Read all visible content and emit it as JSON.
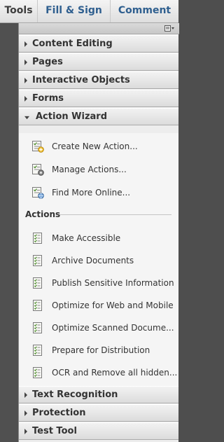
{
  "tabs": [
    {
      "label": "Tools"
    },
    {
      "label": "Fill & Sign"
    },
    {
      "label": "Comment"
    }
  ],
  "panel": {
    "options_icon": "panel-options-icon",
    "sections": {
      "content_editing": "Content Editing",
      "pages": "Pages",
      "interactive_objects": "Interactive Objects",
      "forms": "Forms",
      "action_wizard": "Action Wizard",
      "text_recognition": "Text Recognition",
      "protection": "Protection",
      "test_tool": "Test Tool"
    },
    "wizard": {
      "commands": [
        {
          "label": "Create New Action...",
          "icon": "create-action-icon"
        },
        {
          "label": "Manage Actions...",
          "icon": "manage-actions-icon"
        },
        {
          "label": "Find More Online...",
          "icon": "find-online-icon"
        }
      ],
      "actions_header": "Actions",
      "actions": [
        {
          "label": "Make Accessible",
          "icon": "action-list-icon"
        },
        {
          "label": "Archive Documents",
          "icon": "action-list-icon"
        },
        {
          "label": "Publish Sensitive Information",
          "icon": "action-list-icon"
        },
        {
          "label": "Optimize for Web and Mobile",
          "icon": "action-list-icon"
        },
        {
          "label": "Optimize Scanned Docume...",
          "icon": "action-list-icon"
        },
        {
          "label": "Prepare for Distribution",
          "icon": "action-list-icon"
        },
        {
          "label": "OCR and Remove all hidden...",
          "icon": "action-list-icon"
        }
      ]
    }
  },
  "colors": {
    "tab_active_text": "#3d3d3d",
    "tab_text": "#2f5f8f",
    "panel_bg": "#ededed",
    "side_strip": "#505050"
  }
}
